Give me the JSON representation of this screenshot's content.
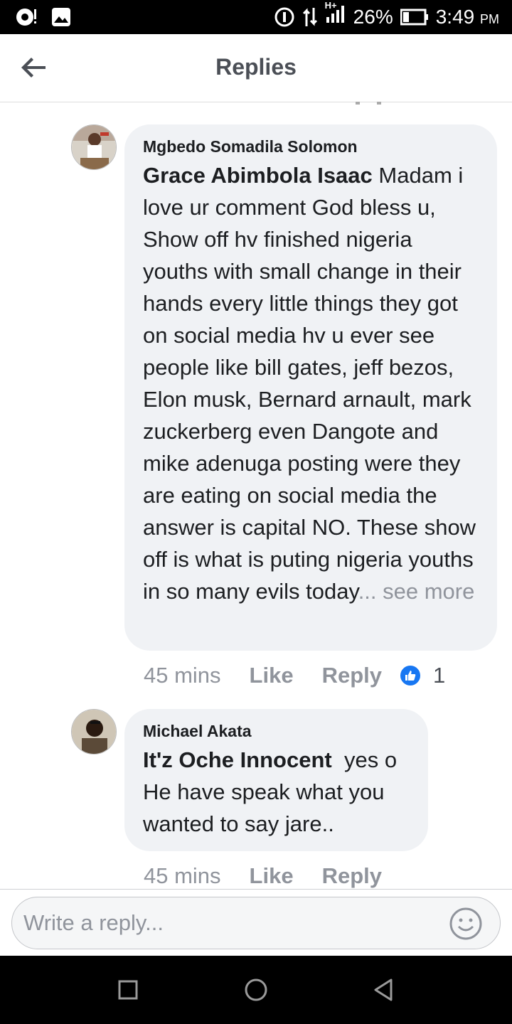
{
  "status_bar": {
    "battery": "26%",
    "time": "3:49",
    "ampm": "PM",
    "network": "H+"
  },
  "header": {
    "title": "Replies"
  },
  "comments": [
    {
      "author": "Mgbedo Somadila Solomon",
      "mention": "Grace Abimbola Isaac",
      "body": " Madam i love ur comment God bless u, Show off hv finished nigeria youths with small change in their hands every little things they got on social media hv u ever see people like bill gates, jeff bezos, Elon musk, Bernard arnault, mark zuckerberg even Dangote and mike adenuga posting were they are eating on social media the answer is capital NO. These show off is what is puting nigeria youths in so many evils today",
      "see_more": "... see more",
      "time": "45 mins",
      "like_label": "Like",
      "reply_label": "Reply",
      "reactions": "1"
    },
    {
      "author": "Michael Akata",
      "mention": "It'z Oche Innocent",
      "body": "  yes o He have speak what you wanted to say jare..",
      "time": "45 mins",
      "like_label": "Like",
      "reply_label": "Reply"
    }
  ],
  "composer": {
    "placeholder": "Write a reply..."
  },
  "colors": {
    "bubble": "#f0f2f5",
    "meta": "#90949c",
    "like_blue": "#1877f2"
  },
  "icons": [
    "back-arrow-icon",
    "like-thumb-icon",
    "emoji-icon",
    "recent-apps-icon",
    "home-icon",
    "back-nav-icon"
  ]
}
